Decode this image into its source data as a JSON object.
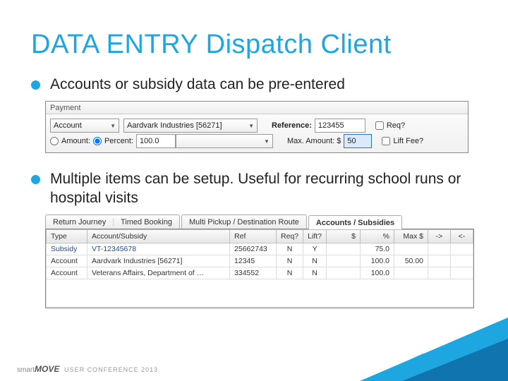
{
  "title": "DATA ENTRY Dispatch Client",
  "bullets": {
    "b1": "Accounts or subsidy data can be pre-entered",
    "b2": "Multiple items can be setup. Useful for recurring school runs or hospital visits"
  },
  "payment": {
    "group": "Payment",
    "type_value": "Account",
    "account_value": "Aardvark Industries [56271]",
    "reference_label": "Reference:",
    "reference_value": "123455",
    "req_label": "Req?",
    "amount_label": "Amount:",
    "percent_label": "Percent:",
    "percent_value": "100.0",
    "max_label": "Max. Amount: $",
    "max_value": "50",
    "lift_label": "Lift Fee?"
  },
  "tabs": {
    "t1a": "Return Journey",
    "t1b": "Timed Booking",
    "t2": "Multi Pickup / Destination Route",
    "t3": "Accounts / Subsidies"
  },
  "grid": {
    "headers": {
      "type": "Type",
      "acc": "Account/Subsidy",
      "ref": "Ref",
      "req": "Req?",
      "lift": "Lift?",
      "amt": "$",
      "pct": "%",
      "max": "Max $",
      "fwd": "->",
      "back": "<-"
    },
    "rows": [
      {
        "type": "Subsidy",
        "acc": "VT-12345678",
        "ref": "25662743",
        "req": "N",
        "lift": "Y",
        "amt": "",
        "pct": "75.0",
        "max": ""
      },
      {
        "type": "Account",
        "acc": "Aardvark Industries [56271]",
        "ref": "12345",
        "req": "N",
        "lift": "N",
        "amt": "",
        "pct": "100.0",
        "max": "50.00"
      },
      {
        "type": "Account",
        "acc": "Veterans Affairs, Department of …",
        "ref": "334552",
        "req": "N",
        "lift": "N",
        "amt": "",
        "pct": "100.0",
        "max": ""
      }
    ]
  },
  "footer": {
    "brand1": "smart",
    "brand2": "MOVE",
    "uc": "USER CONFERENCE",
    "year": "2013"
  }
}
